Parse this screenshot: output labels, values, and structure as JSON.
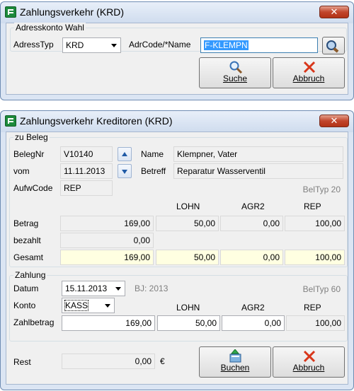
{
  "top_window": {
    "title": "Zahlungsverkehr (KRD)",
    "close_glyph": "✕",
    "group_label": "Adresskonto Wahl",
    "adresstyp_label": "AdressTyp",
    "adresstyp_value": "KRD",
    "adrcode_label": "AdrCode/*Name",
    "adrcode_value": "F-KLEMPN",
    "suche_label": "Suche",
    "abbruch_label": "Abbruch"
  },
  "bottom_window": {
    "title": "Zahlungsverkehr Kreditoren (KRD)",
    "close_glyph": "✕",
    "beleg_group": {
      "label": "zu Beleg",
      "belegnr_label": "BelegNr",
      "belegnr_value": "V10140",
      "vom_label": "vom",
      "vom_value": "11.11.2013",
      "aufwcode_label": "AufwCode",
      "aufwcode_value": "REP",
      "name_label": "Name",
      "name_value": "Klempner, Vater",
      "betreff_label": "Betreff",
      "betreff_value": "Reparatur Wasserventil",
      "beltyp": "BelTyp 20"
    },
    "amounts": {
      "columns": [
        "LOHN",
        "AGR2",
        "REP"
      ],
      "betrag_label": "Betrag",
      "betrag": [
        "169,00",
        "50,00",
        "0,00",
        "100,00"
      ],
      "bezahlt_label": "bezahlt",
      "bezahlt": "0,00",
      "gesamt_label": "Gesamt",
      "gesamt": [
        "169,00",
        "50,00",
        "0,00",
        "100,00"
      ]
    },
    "zahlung_group": {
      "label": "Zahlung",
      "datum_label": "Datum",
      "datum_value": "15.11.2013",
      "bj": "BJ: 2013",
      "beltyp": "BelTyp 60",
      "konto_label": "Konto",
      "konto_value": "KASS",
      "columns": [
        "LOHN",
        "AGR2",
        "REP"
      ],
      "zahlbetrag_label": "Zahlbetrag",
      "zahlbetrag": [
        "169,00",
        "50,00",
        "0,00",
        "100,00"
      ]
    },
    "rest_label": "Rest",
    "rest_value": "0,00",
    "currency": "€",
    "buchen_label": "Buchen",
    "abbruch_label": "Abbruch"
  },
  "colors": {
    "window_frame": "#dbe5f3",
    "highlight_input": "#ffffe1",
    "close_red": "#c1452c",
    "selection_blue": "#3399ff"
  },
  "icons": [
    "app-icon",
    "close-icon",
    "search-icon",
    "cancel-x-icon",
    "book-icon",
    "arrow-up-icon",
    "arrow-down-icon",
    "address-lookup-icon"
  ]
}
